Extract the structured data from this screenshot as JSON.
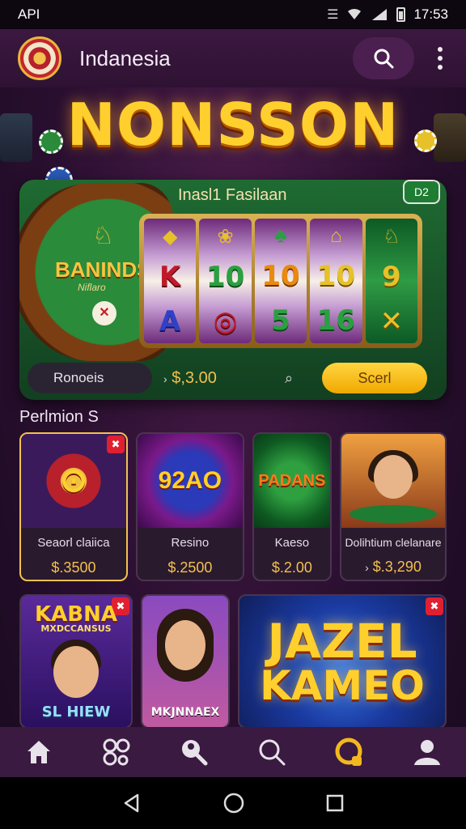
{
  "status_bar": {
    "carrier": "API",
    "time": "17:53"
  },
  "app_bar": {
    "title": "Indanesia",
    "search_icon": "search-icon",
    "menu_icon": "kebab-menu-icon"
  },
  "hero": {
    "title": "NONSSON",
    "panel_title": "Inasl1 Fasilaan",
    "panel_badge": "D2",
    "wheel_label": "BANINDS",
    "wheel_sub": "Niflaro",
    "reels": [
      [
        "K",
        "A"
      ],
      [
        "10",
        "◎"
      ],
      [
        "10",
        "5"
      ],
      [
        "10",
        "16"
      ],
      [
        "9",
        "✕"
      ]
    ],
    "input_value": "Ronoeis",
    "price": "$,3.00",
    "cta_label": "Scerl"
  },
  "section": {
    "title": "Perlmion S",
    "cards": [
      {
        "art": "⊙",
        "name": "Seaorl claiica",
        "price": "$.3500",
        "selected": true
      },
      {
        "art": "92AO",
        "name": "Resino",
        "price": "$.2500",
        "selected": false
      },
      {
        "art": "PADANS",
        "name": "Kaeso",
        "price": "$.2.00",
        "selected": false
      },
      {
        "art": "",
        "name": "Dolihtium clelanare",
        "price": "$.3,290",
        "selected": false
      }
    ]
  },
  "tiles": [
    {
      "top": "KABNA",
      "sub": "MXDCCANSUS",
      "bottom": "SL HIEW"
    },
    {
      "bottom": "MKJNNAEX"
    },
    {
      "line1": "JAZEL",
      "line2": "KAMEO"
    }
  ],
  "bottom_nav": [
    "home-icon",
    "games-icon",
    "search-profile-icon",
    "search-icon",
    "rewards-icon",
    "account-icon"
  ],
  "colors": {
    "accent": "#f2c14e",
    "background": "#2a0f30",
    "nav": "#3a1a40"
  }
}
